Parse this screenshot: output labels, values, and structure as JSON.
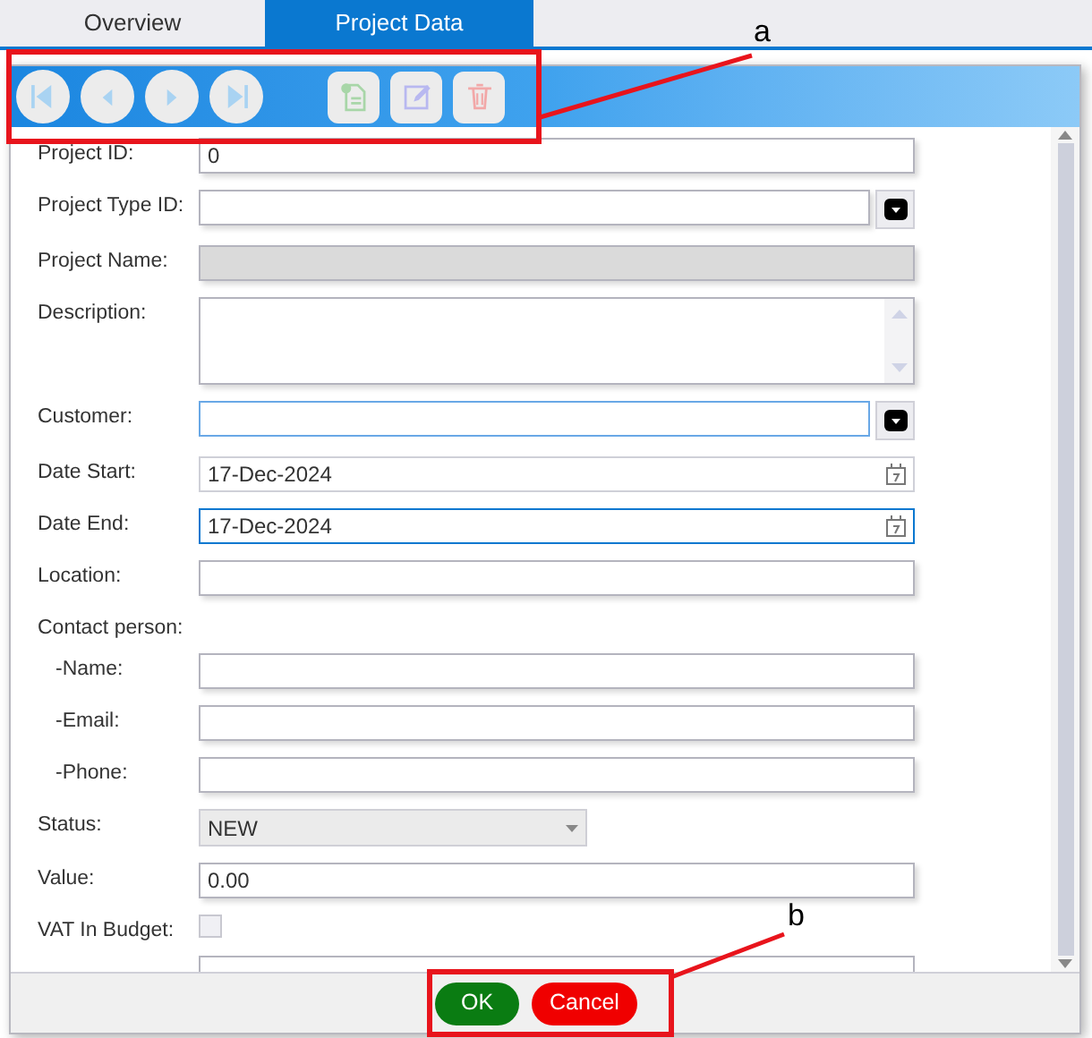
{
  "tabs": [
    {
      "label": "Overview",
      "selected": false
    },
    {
      "label": "Project Data",
      "selected": true
    }
  ],
  "toolbar": [
    {
      "kind": "first",
      "disabled": true
    },
    {
      "kind": "prev",
      "disabled": true
    },
    {
      "kind": "next",
      "disabled": true
    },
    {
      "kind": "last",
      "disabled": true
    },
    {
      "kind": "new",
      "disabled": true
    },
    {
      "kind": "edit",
      "disabled": true
    },
    {
      "kind": "delete",
      "disabled": true
    }
  ],
  "fields": [
    {
      "label": "Project ID:",
      "kind": "text",
      "value": "0",
      "focused": false,
      "disabled": false
    },
    {
      "label": "Project Type ID:",
      "kind": "combo",
      "focused": false,
      "disabled": false
    },
    {
      "label": "Project Name:",
      "kind": "text",
      "focused": false,
      "disabled": true
    },
    {
      "label": "Description:",
      "kind": "textarea",
      "focused": false,
      "disabled": false
    },
    {
      "label": "Customer:",
      "kind": "combo",
      "focused": true,
      "disabled": false
    },
    {
      "label": "Date Start:",
      "kind": "date",
      "value": "17-Dec-2024",
      "focused": false,
      "disabled": false
    },
    {
      "label": "Date End:",
      "kind": "date",
      "value": "17-Dec-2024",
      "focused": true,
      "disabled": false
    },
    {
      "label": "Location:",
      "kind": "text",
      "focused": false,
      "disabled": false
    },
    {
      "label": "Contact person:",
      "kind": "group",
      "children": [
        {
          "label": "-Name:",
          "kind": "text",
          "focused": false,
          "disabled": false
        },
        {
          "label": "-Email:",
          "kind": "text",
          "focused": false,
          "disabled": false
        },
        {
          "label": "-Phone:",
          "kind": "text",
          "focused": false,
          "disabled": false
        }
      ]
    },
    {
      "label": "Status:",
      "kind": "select",
      "value": "NEW",
      "focused": false,
      "disabled": false
    },
    {
      "label": "Value:",
      "kind": "text",
      "value": "0.00",
      "focused": false,
      "disabled": false
    },
    {
      "label": "VAT In Budget:",
      "kind": "checkbox",
      "checked": false
    },
    {
      "kind": "partial"
    }
  ],
  "buttons": [
    {
      "label": "OK",
      "kind": "ok"
    },
    {
      "label": "Cancel",
      "kind": "cancel"
    }
  ],
  "annotations": [
    {
      "label": "a"
    },
    {
      "label": "b"
    }
  ]
}
